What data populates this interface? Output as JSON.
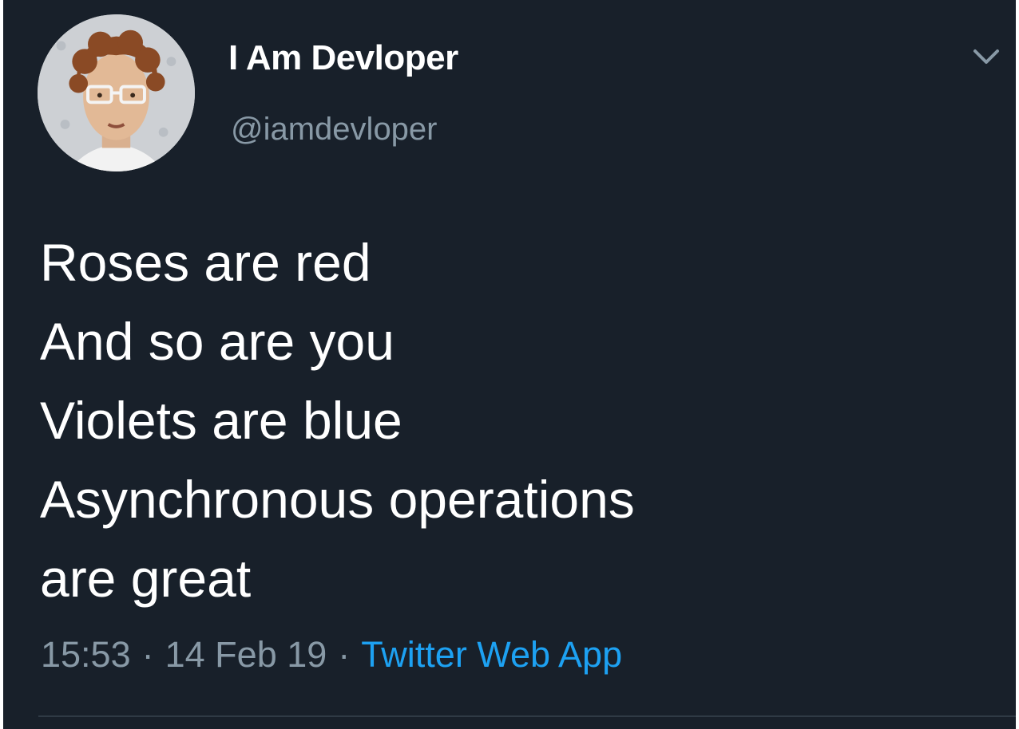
{
  "tweet": {
    "author": {
      "display_name": "I Am Devloper",
      "handle": "@iamdevloper"
    },
    "icons": {
      "menu": "chevron-down-icon",
      "avatar": "profile-photo"
    },
    "text_lines": [
      "Roses are red",
      "And so are you",
      "Violets are blue",
      "Asynchronous operations",
      "are great"
    ],
    "meta": {
      "time": "15:53",
      "separator": "·",
      "date": "14 Feb 19",
      "source": "Twitter Web App"
    },
    "colors": {
      "background": "#18202a",
      "primary_text": "#ffffff",
      "secondary_text": "#8899a6",
      "link": "#1da1f2",
      "divider": "#2f3a45"
    }
  }
}
